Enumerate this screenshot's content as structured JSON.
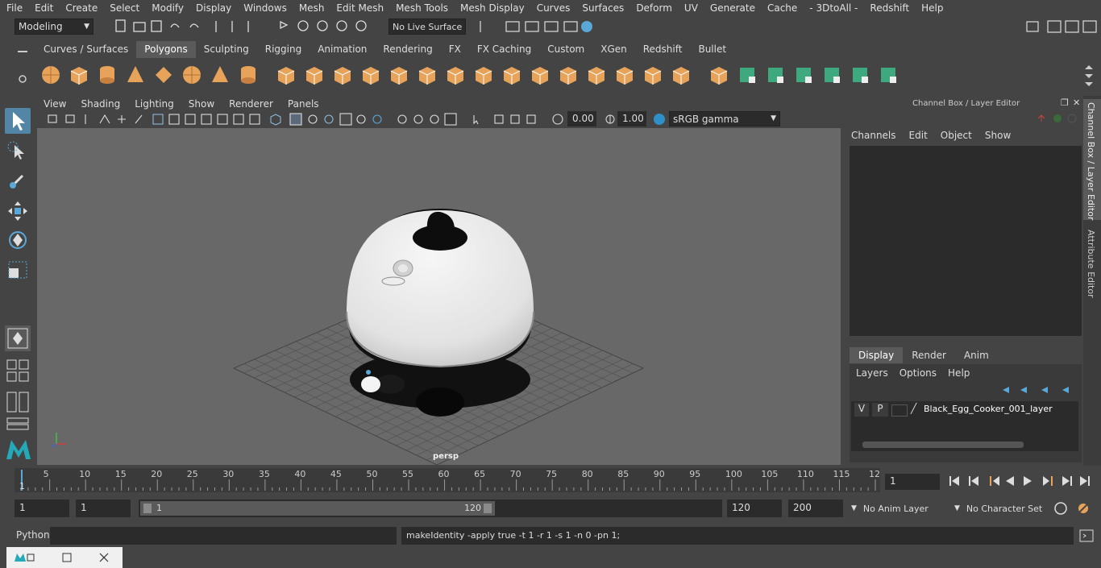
{
  "menu": [
    "File",
    "Edit",
    "Create",
    "Select",
    "Modify",
    "Display",
    "Windows",
    "Mesh",
    "Edit Mesh",
    "Mesh Tools",
    "Mesh Display",
    "Curves",
    "Surfaces",
    "Deform",
    "UV",
    "Generate",
    "Cache",
    "- 3DtoAll -",
    "Redshift",
    "Help"
  ],
  "status": {
    "mode": "Modeling",
    "live_surface": "No Live Surface"
  },
  "shelf_tabs": [
    "Curves / Surfaces",
    "Polygons",
    "Sculpting",
    "Rigging",
    "Animation",
    "Rendering",
    "FX",
    "FX Caching",
    "Custom",
    "XGen",
    "Redshift",
    "Bullet"
  ],
  "shelf_active": "Polygons",
  "viewport": {
    "menu": [
      "View",
      "Shading",
      "Lighting",
      "Show",
      "Renderer",
      "Panels"
    ],
    "exposure": "0.00",
    "gamma": "1.00",
    "colorspace": "sRGB gamma",
    "camera": "persp"
  },
  "channel_box": {
    "title": "Channel Box / Layer Editor",
    "menu": [
      "Channels",
      "Edit",
      "Object",
      "Show"
    ]
  },
  "layer_editor": {
    "tabs": [
      "Display",
      "Render",
      "Anim"
    ],
    "active_tab": "Display",
    "menu": [
      "Layers",
      "Options",
      "Help"
    ],
    "layer": {
      "v": "V",
      "p": "P",
      "name": "Black_Egg_Cooker_001_layer"
    }
  },
  "side_tabs": [
    "Channel Box / Layer Editor",
    "Attribute Editor"
  ],
  "timeline": {
    "ticks": [
      "5",
      "10",
      "15",
      "20",
      "25",
      "30",
      "35",
      "40",
      "45",
      "50",
      "55",
      "60",
      "65",
      "70",
      "75",
      "80",
      "85",
      "90",
      "95",
      "100",
      "105",
      "110",
      "115",
      "12"
    ],
    "start_label": "1",
    "current_frame": "1"
  },
  "range": {
    "start": "1",
    "current": "1",
    "slider_start": "1",
    "slider_end": "120",
    "end": "120",
    "anim_end": "200",
    "anim_layer": "No Anim Layer",
    "character_set": "No Character Set"
  },
  "command": {
    "lang": "Python",
    "output": "makeIdentity -apply true -t 1 -r 1 -s 1 -n 0 -pn 1;"
  },
  "colors": {
    "accent": "#5285a6",
    "shelf_orange": "#e8a35a",
    "shelf_green": "#3ea87f",
    "bg": "#444444"
  }
}
